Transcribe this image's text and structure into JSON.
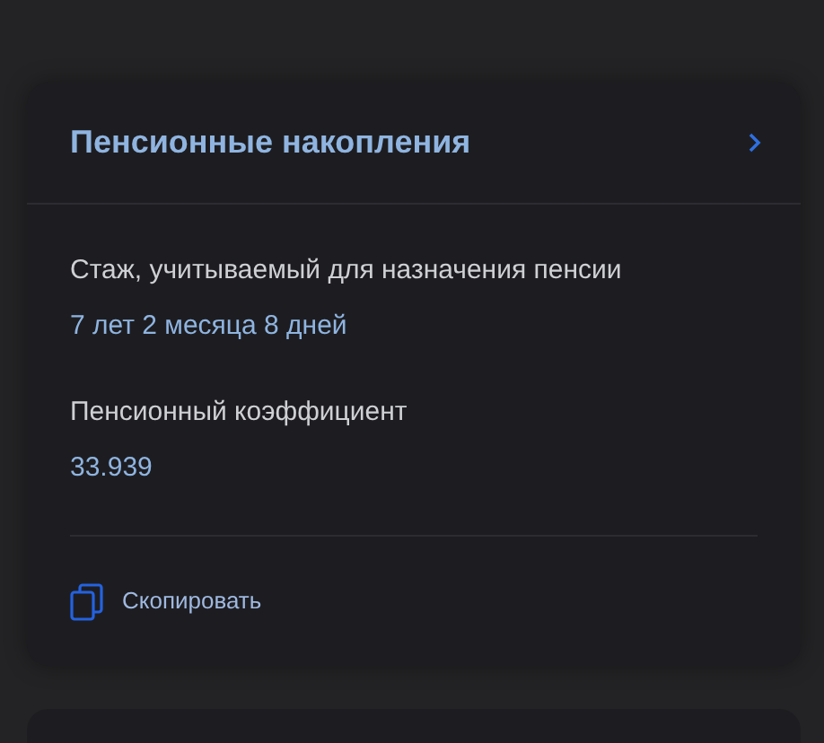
{
  "card": {
    "title": "Пенсионные накопления",
    "fields": [
      {
        "label": "Стаж, учитываемый для назначения пенсии",
        "value": "7 лет 2 месяца 8 дней"
      },
      {
        "label": "Пенсионный коэффициент",
        "value": "33.939"
      }
    ],
    "copy_action": "Скопировать"
  }
}
